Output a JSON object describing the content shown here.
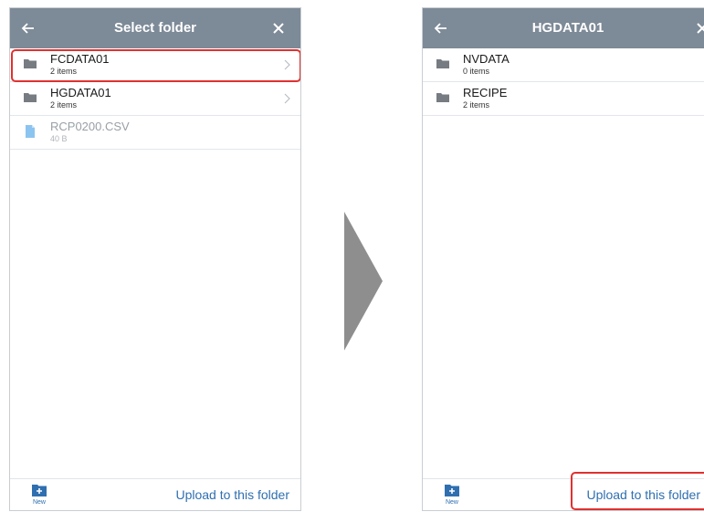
{
  "colors": {
    "titlebar": "#7d8a97",
    "accent_blue": "#2f6fb0",
    "highlight_red": "#e0312f",
    "folder_gray": "#777c82",
    "file_blue": "#8cc4f0",
    "arrow_gray": "#8e8e8e"
  },
  "left_screen": {
    "title": "Select folder",
    "back_icon": "back-arrow-icon",
    "close_icon": "close-icon",
    "items": [
      {
        "name": "FCDATA01",
        "sub": "2 items",
        "type": "folder",
        "highlighted": true
      },
      {
        "name": "HGDATA01",
        "sub": "2 items",
        "type": "folder",
        "highlighted": false
      },
      {
        "name": "RCP0200.CSV",
        "sub": "40 B",
        "type": "file",
        "highlighted": false
      }
    ],
    "footer": {
      "new_label": "New",
      "upload_label": "Upload to this folder"
    }
  },
  "right_screen": {
    "title": "HGDATA01",
    "back_icon": "back-arrow-icon",
    "close_icon": "close-icon",
    "items": [
      {
        "name": "NVDATA",
        "sub": "0 items",
        "type": "folder"
      },
      {
        "name": "RECIPE",
        "sub": "2 items",
        "type": "folder"
      }
    ],
    "footer": {
      "new_label": "New",
      "upload_label": "Upload to this folder",
      "upload_highlighted": true
    }
  },
  "transition_icon": "right-triangle-arrow-icon"
}
